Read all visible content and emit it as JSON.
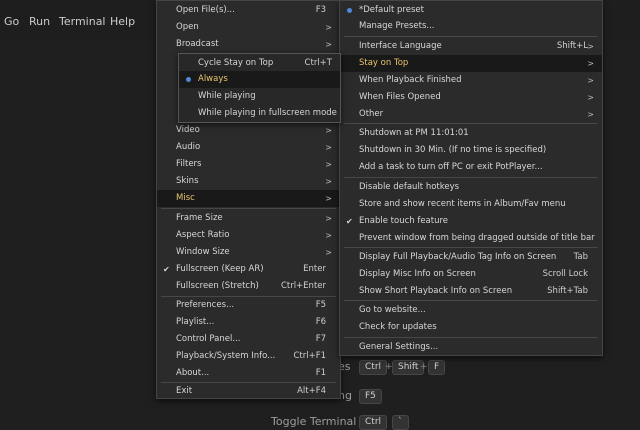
{
  "menubar": {
    "items": [
      "Go",
      "Run",
      "Terminal",
      "Help"
    ]
  },
  "hints": {
    "row1_label": "es",
    "row1_keys": [
      "Ctrl",
      "Shift",
      "F"
    ],
    "row2_label": "ng",
    "row2_key": "F5",
    "row3_label": "Toggle Terminal",
    "row3_keys": [
      "Ctrl",
      "`"
    ]
  },
  "main_menu": {
    "items": [
      {
        "label": "Open File(s)...",
        "shortcut": "F3"
      },
      {
        "label": "Open",
        "arrow": true
      },
      {
        "label": "Broadcast",
        "arrow": true
      },
      {
        "label": "Video",
        "arrow": true
      },
      {
        "label": "Audio",
        "arrow": true
      },
      {
        "label": "Filters",
        "arrow": true
      },
      {
        "label": "Skins",
        "arrow": true
      },
      {
        "label": "Misc",
        "arrow": true,
        "highlighted": true
      },
      {
        "label": "Frame Size",
        "arrow": true
      },
      {
        "label": "Aspect Ratio",
        "arrow": true
      },
      {
        "label": "Window Size",
        "arrow": true
      },
      {
        "label": "Fullscreen (Keep AR)",
        "shortcut": "Enter",
        "checked": true
      },
      {
        "label": "Fullscreen (Stretch)",
        "shortcut": "Ctrl+Enter"
      },
      {
        "label": "Preferences...",
        "shortcut": "F5"
      },
      {
        "label": "Playlist...",
        "shortcut": "F6"
      },
      {
        "label": "Control Panel...",
        "shortcut": "F7"
      },
      {
        "label": "Playback/System Info...",
        "shortcut": "Ctrl+F1"
      },
      {
        "label": "About...",
        "shortcut": "F1"
      },
      {
        "label": "Exit",
        "shortcut": "Alt+F4"
      }
    ]
  },
  "stay_on_top_submenu": {
    "items": [
      {
        "label": "Cycle Stay on Top",
        "shortcut": "Ctrl+T"
      },
      {
        "label": "Always",
        "selected": true
      },
      {
        "label": "While playing"
      },
      {
        "label": "While playing in fullscreen mode"
      }
    ]
  },
  "misc_menu": {
    "items": [
      {
        "label": "*Default preset",
        "selected": true
      },
      {
        "label": "Manage Presets..."
      },
      {
        "label": "Interface Language",
        "shortcut": "Shift+L"
      },
      {
        "label": "Stay on Top",
        "arrow": true,
        "highlighted": true
      },
      {
        "label": "When Playback Finished",
        "arrow": true
      },
      {
        "label": "When Files Opened",
        "arrow": true
      },
      {
        "label": "Other",
        "arrow": true
      },
      {
        "label": "Shutdown at PM 11:01:01"
      },
      {
        "label": "Shutdown in 30 Min. (If no time is specified)"
      },
      {
        "label": "Add a task to turn off PC or exit PotPlayer..."
      },
      {
        "label": "Disable default hotkeys"
      },
      {
        "label": "Store and show recent items in Album/Fav menu"
      },
      {
        "label": "Enable touch feature",
        "checked": true
      },
      {
        "label": "Prevent window from being dragged outside of title bar"
      },
      {
        "label": "Display Full Playback/Audio Tag Info on Screen",
        "shortcut": "Tab"
      },
      {
        "label": "Display Misc Info on Screen",
        "shortcut": "Scroll Lock"
      },
      {
        "label": "Show Short Playback Info on Screen",
        "shortcut": "Shift+Tab"
      },
      {
        "label": "Go to website..."
      },
      {
        "label": "Check for updates"
      },
      {
        "label": "General Settings..."
      }
    ]
  },
  "icons": {
    "check": "check-icon",
    "radio": "radio-dot-icon",
    "arrow": "chevron-right-icon"
  },
  "colors": {
    "menu_bg": "#2b2b2b",
    "highlight_text": "#e9c46a",
    "radio_dot": "#4f8ad8"
  }
}
